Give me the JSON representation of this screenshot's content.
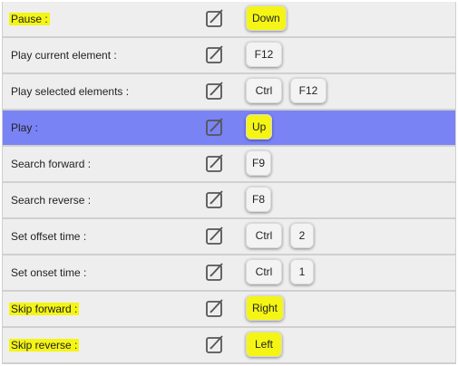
{
  "shortcuts": [
    {
      "action": "Pause :",
      "keys": [
        "Down"
      ],
      "highlight_label": true,
      "highlight_keys": true,
      "selected": false
    },
    {
      "action": "Play current element :",
      "keys": [
        "F12"
      ],
      "highlight_label": false,
      "highlight_keys": false,
      "selected": false
    },
    {
      "action": "Play selected elements :",
      "keys": [
        "Ctrl",
        "F12"
      ],
      "highlight_label": false,
      "highlight_keys": false,
      "selected": false
    },
    {
      "action": "Play :",
      "keys": [
        "Up"
      ],
      "highlight_label": false,
      "highlight_keys": true,
      "selected": true
    },
    {
      "action": "Search forward :",
      "keys": [
        "F9"
      ],
      "highlight_label": false,
      "highlight_keys": false,
      "selected": false
    },
    {
      "action": "Search reverse :",
      "keys": [
        "F8"
      ],
      "highlight_label": false,
      "highlight_keys": false,
      "selected": false
    },
    {
      "action": "Set offset time :",
      "keys": [
        "Ctrl",
        "2"
      ],
      "highlight_label": false,
      "highlight_keys": false,
      "selected": false
    },
    {
      "action": "Set onset time :",
      "keys": [
        "Ctrl",
        "1"
      ],
      "highlight_label": false,
      "highlight_keys": false,
      "selected": false
    },
    {
      "action": "Skip forward :",
      "keys": [
        "Right"
      ],
      "highlight_label": true,
      "highlight_keys": true,
      "selected": false
    },
    {
      "action": "Skip reverse :",
      "keys": [
        "Left"
      ],
      "highlight_label": true,
      "highlight_keys": true,
      "selected": false
    }
  ],
  "icons": {
    "edit": "edit-pencil-icon"
  },
  "colors": {
    "selected_row": "#7a83f4",
    "highlight": "#f4f514",
    "row_bg": "#eeeeee"
  }
}
